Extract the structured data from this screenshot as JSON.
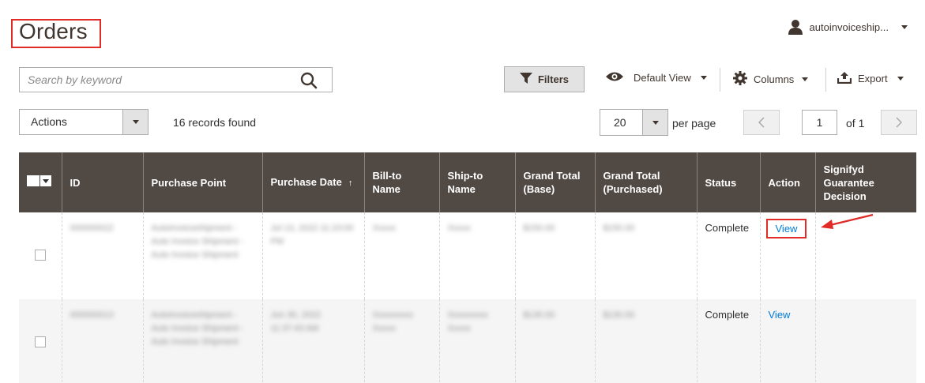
{
  "header": {
    "title": "Orders",
    "username": "autoinvoiceship..."
  },
  "toolbar": {
    "search_placeholder": "Search by keyword",
    "filters_label": "Filters",
    "view_label": "Default View",
    "columns_label": "Columns",
    "export_label": "Export"
  },
  "actions": {
    "label": "Actions",
    "records_found": "16 records found"
  },
  "pager": {
    "per_page_value": "20",
    "per_page_label": "per page",
    "current_page": "1",
    "of_label": "of 1"
  },
  "table": {
    "columns": [
      "ID",
      "Purchase Point",
      "Purchase Date",
      "Bill-to Name",
      "Ship-to Name",
      "Grand Total (Base)",
      "Grand Total (Purchased)",
      "Status",
      "Action",
      "Signifyd Guarantee Decision"
    ],
    "rows": [
      {
        "id": "000000022",
        "purchase_point": "Autoinvoiceshipment - Auto Invoice Shipment - Auto Invoice Shipment",
        "purchase_date": "Jul 13, 2022 11:23:00 PM",
        "bill_to": "Xxxxx",
        "ship_to": "Xxxxx",
        "grand_total_base": "$150.00",
        "grand_total_purchased": "$150.00",
        "status": "Complete",
        "action": "View"
      },
      {
        "id": "000000013",
        "purchase_point": "Autoinvoiceshipment - Auto Invoice Shipment - Auto Invoice Shipment",
        "purchase_date": "Jun 30, 2022 11:37:43 AM",
        "bill_to": "Xxxxxxxxx Xxxxx",
        "ship_to": "Xxxxxxxxx Xxxxx",
        "grand_total_base": "$130.00",
        "grand_total_purchased": "$130.00",
        "status": "Complete",
        "action": "View"
      }
    ]
  },
  "colors": {
    "header_bg": "#514943",
    "link": "#007bdb",
    "highlight": "#e02b27"
  }
}
